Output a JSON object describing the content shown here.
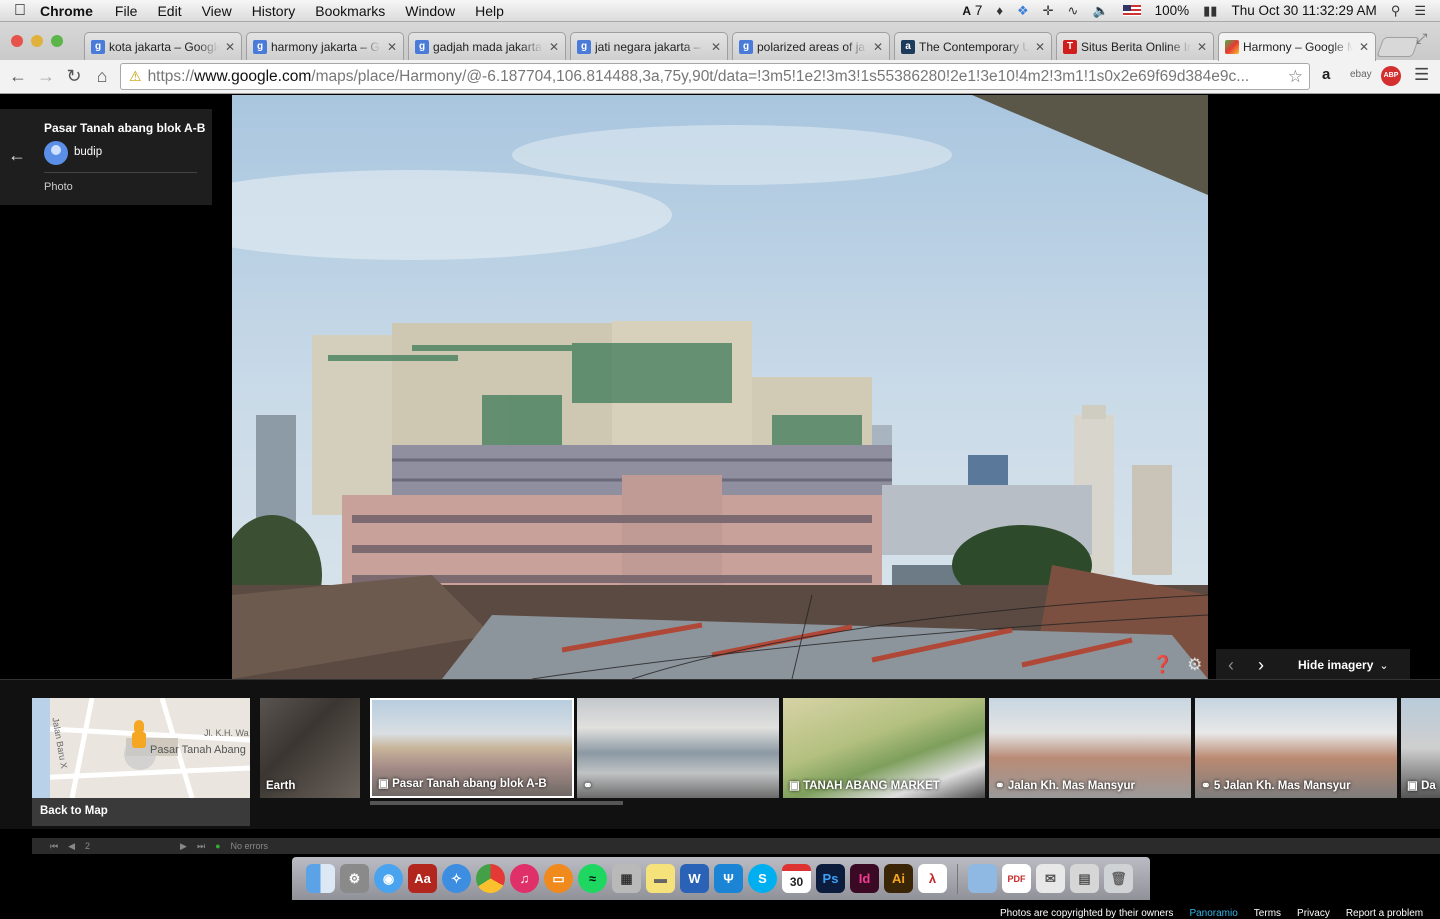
{
  "menubar": {
    "apple": "",
    "app": "Chrome",
    "menus": [
      "File",
      "Edit",
      "View",
      "History",
      "Bookmarks",
      "Window",
      "Help"
    ],
    "adobe_count": "7",
    "battery": "100%",
    "clock": "Thu Oct 30  11:32:29 AM"
  },
  "tabs": [
    {
      "title": "kota jakarta – Google",
      "favicon": "google",
      "active": false
    },
    {
      "title": "harmony jakarta – G",
      "favicon": "google",
      "active": false
    },
    {
      "title": "gadjah mada jakarta",
      "favicon": "google",
      "active": false
    },
    {
      "title": "jati negara jakarta –",
      "favicon": "google",
      "active": false
    },
    {
      "title": "polarized areas of ja",
      "favicon": "google",
      "active": false
    },
    {
      "title": "The Contemporary U",
      "favicon": "academia",
      "active": false
    },
    {
      "title": "Situs Berita Online In",
      "favicon": "tempo",
      "active": false
    },
    {
      "title": "Harmony – Google M",
      "favicon": "maps",
      "active": true
    }
  ],
  "address": {
    "scheme": "https://",
    "host": "www.google.com",
    "path": "/maps/place/Harmony/@-6.187704,106.814488,3a,75y,90t/data=!3m5!1e2!3m3!1s55386280!2e1!3e10!4m2!3m1!1s0x2e69f69d384e9c..."
  },
  "infocard": {
    "title": "Pasar Tanah abang blok A-B",
    "user": "budip",
    "type": "Photo"
  },
  "controls": {
    "hide_imagery": "Hide imagery"
  },
  "map_thumb": {
    "street1": "Jl. K.H. Wa",
    "street2": "Jalan Baru X",
    "place": "Pasar Tanah Abang",
    "label": "Back to Map"
  },
  "thumbs": [
    {
      "label": "Earth",
      "icon": "none"
    },
    {
      "label": "Pasar Tanah abang blok A-B",
      "icon": "camera-icon"
    },
    {
      "label": "",
      "icon": "panorama-icon"
    },
    {
      "label": "TANAH ABANG MARKET",
      "icon": "camera-icon"
    },
    {
      "label": "Jalan Kh. Mas Mansyur",
      "icon": "panorama-icon"
    },
    {
      "label": "5 Jalan Kh. Mas Mansyur",
      "icon": "panorama-icon"
    },
    {
      "label": "Da",
      "icon": "camera-icon"
    }
  ],
  "footer": {
    "copyright": "Photos are copyrighted by their owners",
    "panoramio": "Panoramio",
    "terms": "Terms",
    "privacy": "Privacy",
    "report": "Report a problem"
  },
  "statusbar": {
    "errors": "No errors",
    "page": "2"
  },
  "dock_icons": [
    "finder",
    "system-preferences",
    "messages",
    "dictionary",
    "safari",
    "chrome",
    "itunes",
    "ibooks",
    "spotify",
    "calculator",
    "stickies",
    "word",
    "vuze",
    "skype",
    "calendar",
    "photoshop",
    "indesign",
    "illustrator",
    "acrobat",
    "folder",
    "pdf",
    "mail",
    "trash"
  ],
  "dock_calendar_day": "30"
}
